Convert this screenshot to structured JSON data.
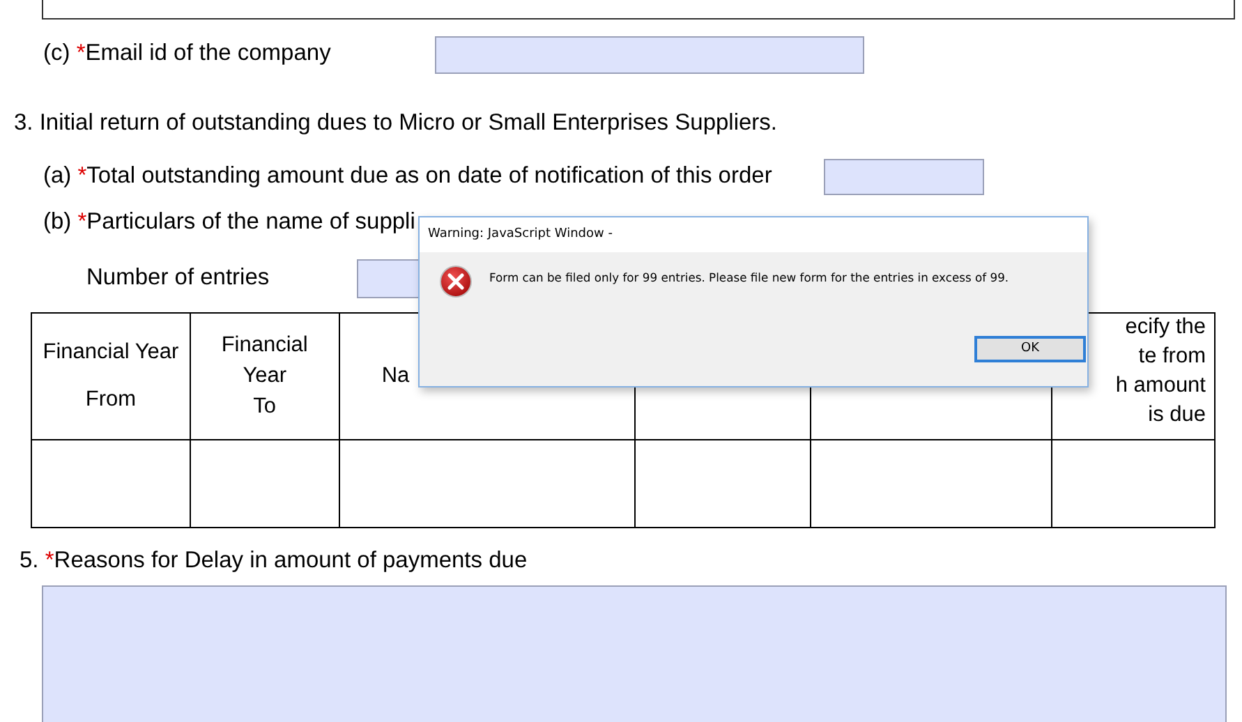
{
  "email_row": {
    "marker": "(c)",
    "required_mark": "*",
    "label": "Email id of the company"
  },
  "section_3": {
    "heading": "3. Initial return of outstanding dues to Micro or Small Enterprises Suppliers.",
    "item_a": {
      "marker": "(a)",
      "required_mark": "*",
      "label": "Total outstanding amount due as on date of notification of this order"
    },
    "item_b": {
      "marker": "(b)",
      "required_mark": "*",
      "label": "Particulars of the name of suppli"
    },
    "entries_label": "Number of entries",
    "table": {
      "columns": [
        {
          "lines": [
            "Financial Year",
            "From"
          ]
        },
        {
          "lines": [
            "Financial",
            "Year",
            "To"
          ]
        },
        {
          "lines": [
            "Na"
          ]
        },
        {},
        {},
        {
          "lines": [
            "ecify the",
            "te from",
            "h amount",
            "is due"
          ]
        }
      ]
    }
  },
  "section_5": {
    "marker": "5.",
    "required_mark": "*",
    "label": "Reasons for Delay in amount of payments due"
  },
  "dialog": {
    "title": "Warning: JavaScript Window -",
    "message": "Form can be filed only for 99 entries. Please file new form for the entries in excess of 99.",
    "buttons": [
      "OK"
    ]
  }
}
